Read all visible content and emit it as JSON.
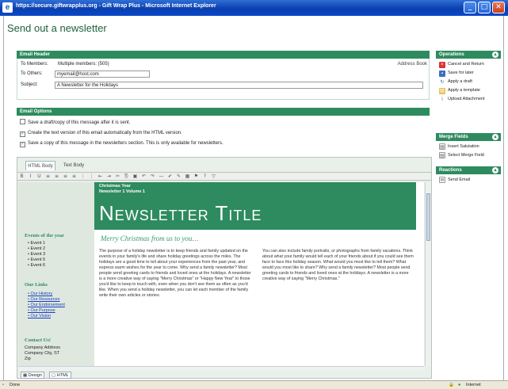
{
  "window": {
    "title": "https://secure.giftwrapplus.org - Gift Wrap Plus - Microsoft Internet Explorer",
    "minimize": "_",
    "maximize": "□",
    "close": "✕"
  },
  "page": {
    "title": "Send out a newsletter"
  },
  "email_header": {
    "heading": "Email Header",
    "to_members_label": "To Members:",
    "to_members_value": "Multiple members: (505)",
    "address_book_link": "Address Book",
    "to_others_label": "To Others:",
    "to_others_value": "myemail@host.com",
    "subject_label": "Subject:",
    "subject_value": "A Newsletter for the Holidays"
  },
  "email_options": {
    "heading": "Email Options",
    "options": [
      {
        "label": "Save a draft/copy of this message after it is sent.",
        "checked": false
      },
      {
        "label": "Create the text version of this email automatically from the HTML version.",
        "checked": true
      },
      {
        "label": "Save a copy of this message in the newsletters section. This is only available for newsletters.",
        "checked": true
      }
    ]
  },
  "editor": {
    "tabs": [
      "HTML Body",
      "Text Body"
    ],
    "toolbar_glyphs": [
      "B",
      "I",
      "U",
      "≡",
      "≡",
      "≡",
      "≡",
      "⋮",
      "⋮",
      "⇤",
      "⇥",
      "✂",
      "⎘",
      "▣",
      "↶",
      "↷",
      "—",
      "✔",
      "✎",
      "▦",
      "⚑",
      "?",
      "▽"
    ],
    "mode_tabs": [
      "Design",
      "HTML"
    ]
  },
  "newsletter": {
    "issue_name": "Christmas Year",
    "issue_number": "Newsletter 1 Volume 1",
    "title": "Newsletter Title",
    "greeting": "Merry Christmas from us to you…",
    "events_heading": "Events of the year",
    "events": [
      "Event 1",
      "Event 2",
      "Event 3",
      "Event 5",
      "Event 6"
    ],
    "links_heading": "Our Links",
    "links": [
      "Our History",
      "Our Resources",
      "Our Endorsement",
      "Our Purpose",
      "Our Vision"
    ],
    "contact_heading": "Contact Us!",
    "contact_lines": [
      "Company Address",
      "Company City, ST",
      "Zip"
    ],
    "para_left": "The purpose of a holiday newsletter is to keep friends and family updated on the events in your family's life and share holiday greetings across the miles. The holidays are a good time to tell about your experiences from the past year, and express warm wishes for the year to come. Why send a family newsletter? Most people send greeting cards to friends and loved ones at the holidays. A newsletter is a more creative way of saying \"Merry Christmas\" or \"Happy New Year\" to those you'd like to keep in touch with, even when you don't see them as often as you'd like. When you send a holiday newsletter, you can let each member of the family write their own articles or stories.",
    "para_right": "You can also include family portraits, or photographs from family vacations. Think about what your family would tell each of your friends about if you could see them face to face this holiday season. What would you most like to tell them? What would you most like to share? Why send a family newsletter? Most people send greeting cards to friends and loved ones at the holidays. A newsletter is a more creative way of saying \"Merry Christmas.\""
  },
  "operations": {
    "heading": "Operations",
    "items": [
      "Cancel and Return",
      "Save for later",
      "Apply a draft",
      "Apply a template",
      "Upload Attachment"
    ]
  },
  "merge_fields": {
    "heading": "Merge Fields",
    "items": [
      "Insert Salutation",
      "Select Merge Field"
    ]
  },
  "reactions": {
    "heading": "Reactions",
    "items": [
      "Send Email"
    ]
  },
  "statusbar": {
    "left": "Done",
    "zone": "Internet"
  },
  "colors": {
    "accent_green": "#2e8b5f",
    "title_blue": "#0a3fb0",
    "link_blue": "#1a3fbf"
  }
}
